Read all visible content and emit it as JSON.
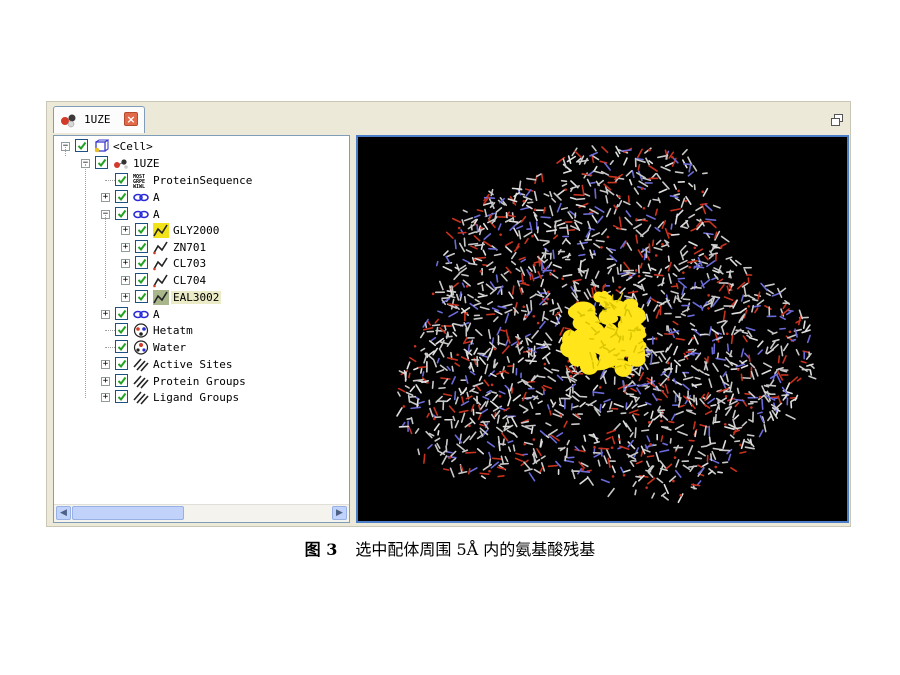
{
  "tab": {
    "label": "1UZE",
    "close_glyph": "×"
  },
  "tree": {
    "rows": [
      {
        "label": "<Cell>",
        "icon": "cell-icon"
      },
      {
        "label": "1UZE",
        "icon": "molecule-icon"
      },
      {
        "label": "ProteinSequence",
        "icon": "sequence-icon"
      },
      {
        "label": "A",
        "icon": "chain-icon"
      },
      {
        "label": "A",
        "icon": "chain-icon"
      },
      {
        "label": "GLY2000",
        "icon": "ligand-icon"
      },
      {
        "label": "ZN701",
        "icon": "ligand-icon"
      },
      {
        "label": "CL703",
        "icon": "ligand-icon"
      },
      {
        "label": "CL704",
        "icon": "ligand-icon"
      },
      {
        "label": "EAL3002",
        "icon": "ligand-icon"
      },
      {
        "label": "A",
        "icon": "chain-icon"
      },
      {
        "label": "Hetatm",
        "icon": "hetatm-icon"
      },
      {
        "label": "Water",
        "icon": "water-icon"
      },
      {
        "label": "Active Sites",
        "icon": "group-icon"
      },
      {
        "label": "Protein Groups",
        "icon": "group-icon"
      },
      {
        "label": "Ligand Groups",
        "icon": "group-icon"
      }
    ]
  },
  "caption": {
    "figure_no": "图 3",
    "text": "选中配体周围 5Å 内的氨基酸残基"
  },
  "colors": {
    "viewer_background": "#000000",
    "highlight_residues": "#ffe51a",
    "atom_carbon": "#c8c8c8",
    "atom_oxygen": "#c8321e",
    "atom_nitrogen": "#6a6ad8"
  }
}
